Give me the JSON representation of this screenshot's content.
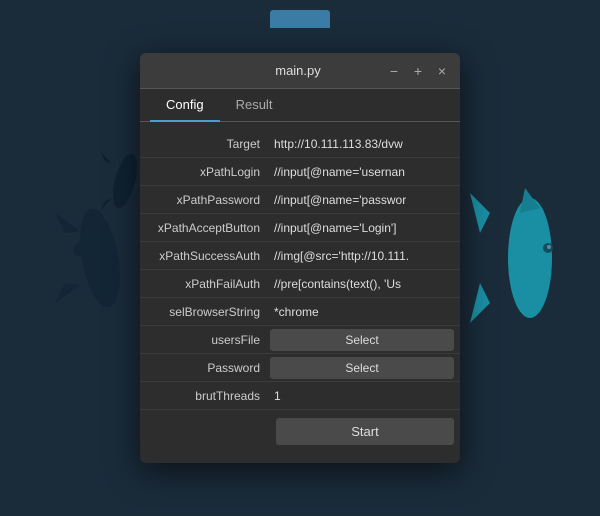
{
  "background": {
    "color": "#1a2b3a"
  },
  "titlebar": {
    "title": "main.py",
    "minimize_label": "−",
    "maximize_label": "+",
    "close_label": "×"
  },
  "tabs": [
    {
      "label": "Config",
      "active": true
    },
    {
      "label": "Result",
      "active": false
    }
  ],
  "form": {
    "rows": [
      {
        "label": "Target",
        "value": "http://10.111.113.83/dvw",
        "type": "text"
      },
      {
        "label": "xPathLogin",
        "value": "//input[@name='usernan",
        "type": "text"
      },
      {
        "label": "xPathPassword",
        "value": "//input[@name='passwor",
        "type": "text"
      },
      {
        "label": "xPathAcceptButton",
        "value": "//input[@name='Login']",
        "type": "text"
      },
      {
        "label": "xPathSuccessAuth",
        "value": "//img[@src='http://10.111.",
        "type": "text"
      },
      {
        "label": "xPathFailAuth",
        "value": "//pre[contains(text(), 'Us",
        "type": "text"
      },
      {
        "label": "selBrowserString",
        "value": "*chrome",
        "type": "text"
      },
      {
        "label": "usersFile",
        "value": "Select",
        "type": "button"
      },
      {
        "label": "Password",
        "value": "Select",
        "type": "button"
      },
      {
        "label": "brutThreads",
        "value": "1",
        "type": "text"
      }
    ],
    "start_button_label": "Start"
  }
}
